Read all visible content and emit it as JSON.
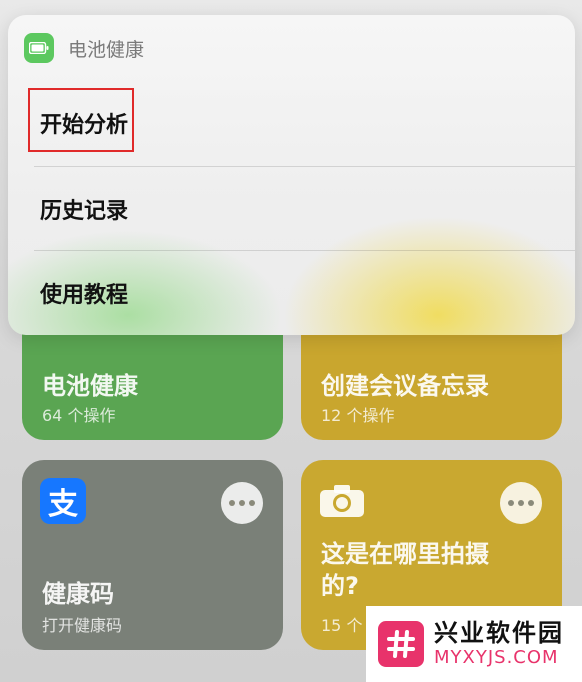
{
  "menu": {
    "app_title": "电池健康",
    "app_icon": "battery-icon",
    "items": [
      {
        "label": "开始分析",
        "highlighted": true
      },
      {
        "label": "历史记录"
      },
      {
        "label": "使用教程"
      }
    ],
    "highlight_color": "#e02a2a"
  },
  "tiles": [
    {
      "title": "电池健康",
      "subtitle": "64 个操作",
      "color": "#5aa552"
    },
    {
      "title": "创建会议备忘录",
      "subtitle": "12 个操作",
      "color": "#c9a62e"
    },
    {
      "title": "健康码",
      "subtitle": "打开健康码",
      "icon": "alipay-icon",
      "icon_glyph": "支",
      "color": "#7a8078"
    },
    {
      "title_line1": "这是在哪里拍摄",
      "title_line2": "的?",
      "subtitle": "15 个",
      "icon": "camera-icon",
      "color": "#c9a830"
    }
  ],
  "watermark": {
    "name": "兴业软件园",
    "url": "MYXYJS.COM"
  }
}
